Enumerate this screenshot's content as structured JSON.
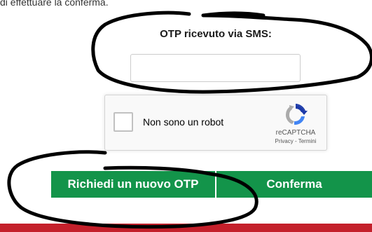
{
  "intro_text": "di effettuare la conferma.",
  "otp": {
    "label": "OTP ricevuto via SMS:",
    "value": "",
    "placeholder": ""
  },
  "recaptcha": {
    "checkbox_label": "Non sono un robot",
    "brand": "reCAPTCHA",
    "privacy_link": "Privacy",
    "separator": " - ",
    "terms_link": "Termini",
    "logo_icon": "recaptcha-logo-icon"
  },
  "buttons": {
    "request_new_otp": "Richiedi un nuovo OTP",
    "confirm": "Conferma"
  },
  "colors": {
    "button_green": "#13944a",
    "footer_red": "#c4202b",
    "ink": "#000000"
  }
}
